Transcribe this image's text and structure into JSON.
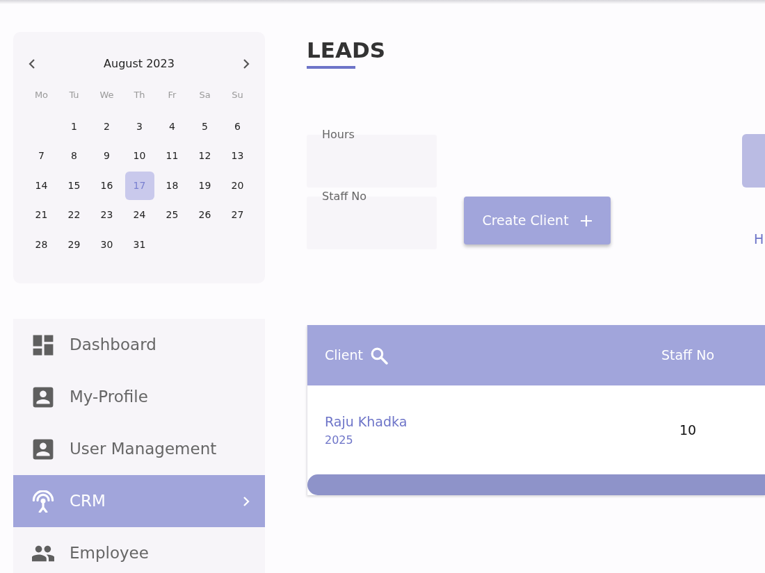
{
  "calendar": {
    "month": "August 2023",
    "weekdays": [
      "Mo",
      "Tu",
      "We",
      "Th",
      "Fr",
      "Sa",
      "Su"
    ],
    "weeks": [
      [
        {
          "day": "1",
          "selected": false
        },
        {
          "day": "2",
          "selected": false
        },
        {
          "day": "3",
          "selected": false
        },
        {
          "day": "4",
          "selected": false
        },
        {
          "day": "5",
          "selected": false
        },
        {
          "day": "6",
          "selected": false
        }
      ],
      [
        {
          "day": "7",
          "selected": false
        },
        {
          "day": "8",
          "selected": false
        },
        {
          "day": "9",
          "selected": false
        },
        {
          "day": "10",
          "selected": false
        },
        {
          "day": "11",
          "selected": false
        },
        {
          "day": "12",
          "selected": false
        },
        {
          "day": "13",
          "selected": false
        }
      ],
      [
        {
          "day": "14",
          "selected": false
        },
        {
          "day": "15",
          "selected": false
        },
        {
          "day": "16",
          "selected": false
        },
        {
          "day": "17",
          "selected": true
        },
        {
          "day": "18",
          "selected": false
        },
        {
          "day": "19",
          "selected": false
        },
        {
          "day": "20",
          "selected": false
        }
      ],
      [
        {
          "day": "21",
          "selected": false
        },
        {
          "day": "22",
          "selected": false
        },
        {
          "day": "23",
          "selected": false
        },
        {
          "day": "24",
          "selected": false
        },
        {
          "day": "25",
          "selected": false
        },
        {
          "day": "26",
          "selected": false
        },
        {
          "day": "27",
          "selected": false
        }
      ],
      [
        {
          "day": "28",
          "selected": false
        },
        {
          "day": "29",
          "selected": false
        },
        {
          "day": "30",
          "selected": false
        },
        {
          "day": "31",
          "selected": false
        }
      ]
    ]
  },
  "sidebar": {
    "items": [
      {
        "label": "Dashboard",
        "selected": false,
        "submenu": false
      },
      {
        "label": "My-Profile",
        "selected": false,
        "submenu": false
      },
      {
        "label": "User Management",
        "selected": false,
        "submenu": false
      },
      {
        "label": "CRM",
        "selected": true,
        "submenu": true
      },
      {
        "label": "Employee",
        "selected": false,
        "submenu": false
      }
    ]
  },
  "page": {
    "title": "LEADS"
  },
  "form": {
    "fields": [
      {
        "label": "Hours"
      },
      {
        "label": "Staff No"
      }
    ],
    "create_button": {
      "label": "Create Client"
    },
    "edge_text": "H"
  },
  "table": {
    "columns": [
      {
        "label": "Client",
        "searchable": true
      },
      {
        "label": "Staff No",
        "searchable": false
      }
    ],
    "rows": [
      {
        "client": "Raju Khadka",
        "year": "2025",
        "staff_no": "10"
      }
    ]
  }
}
